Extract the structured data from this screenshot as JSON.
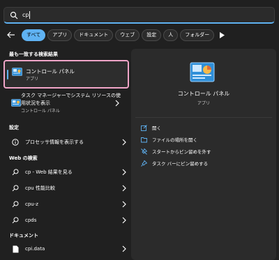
{
  "search": {
    "query": "cp"
  },
  "filters": {
    "chips": [
      "すべて",
      "アプリ",
      "ドキュメント",
      "ウェブ",
      "設定",
      "人",
      "フォルダー"
    ]
  },
  "sections": {
    "best_match": "最も一致する検索結果",
    "settings": "設定",
    "web": "Web の検索",
    "documents": "ドキュメント"
  },
  "best_match": {
    "title": "コントロール パネル",
    "subtitle": "アプリ"
  },
  "task_manager": {
    "line1": "タスク マネージャーでシステム リソースの使",
    "line2": "用状況を表示",
    "line3": "コントロール パネル"
  },
  "settings_items": [
    {
      "label": "プロセッサ情報を表示する"
    }
  ],
  "web_items": [
    {
      "label": "cp - Web 結果を見る"
    },
    {
      "label": "cpu 性能比較"
    },
    {
      "label": "cpu-z"
    },
    {
      "label": "cpds"
    }
  ],
  "document_items": [
    {
      "label": "cpi.data"
    }
  ],
  "detail": {
    "title": "コントロール パネル",
    "subtitle": "アプリ",
    "actions": [
      {
        "label": "開く",
        "icon": "open-icon"
      },
      {
        "label": "ファイルの場所を開く",
        "icon": "folder-icon"
      },
      {
        "label": "スタートからピン留めを外す",
        "icon": "unpin-icon"
      },
      {
        "label": "タスク バーにピン留めする",
        "icon": "pin-icon"
      }
    ]
  },
  "colors": {
    "accent": "#5fb2f2",
    "highlight": "#f0a5c8",
    "background": "#202020",
    "panel": "#2b2b2b"
  }
}
